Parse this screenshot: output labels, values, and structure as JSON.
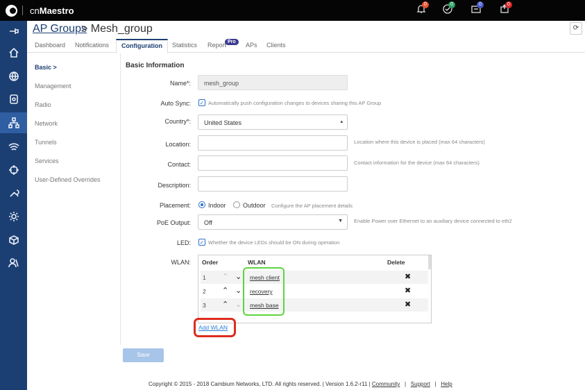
{
  "app": {
    "brand_prefix": "cn",
    "brand_name": "Maestro"
  },
  "topbar": {
    "badges": [
      "0",
      "0",
      "0",
      "0"
    ],
    "badge_colors": [
      "#e2522e",
      "#2f9e63",
      "#4a58c7",
      "#d42a2a"
    ]
  },
  "header": {
    "breadcrumb_link": "AP Groups",
    "breadcrumb_current": "> Mesh_group",
    "refresh_icon": "refresh-icon"
  },
  "tabs": [
    "Dashboard",
    "Notifications",
    "Configuration",
    "Statistics",
    "Report",
    "APs",
    "Clients"
  ],
  "pro_badge": "Pro",
  "leftnav": [
    "Basic >",
    "Management",
    "Radio",
    "Network",
    "Tunnels",
    "Services",
    "User-Defined Overrides"
  ],
  "form": {
    "section_title": "Basic Information",
    "name": {
      "label": "Name*:",
      "value": "mesh_group"
    },
    "autosync": {
      "label": "Auto Sync:",
      "hint": "Automatically push configuration changes to devices sharing this AP Group"
    },
    "country": {
      "label": "Country*:",
      "value": "United States"
    },
    "location": {
      "label": "Location:",
      "hint": "Location where this device is placed (max 64 characters)"
    },
    "contact": {
      "label": "Contact:",
      "hint": "Contact information for the device (max 64 characters)"
    },
    "description": {
      "label": "Description:"
    },
    "placement": {
      "label": "Placement:",
      "options": [
        "Indoor",
        "Outdoor"
      ],
      "hint": "Configure the AP placement details"
    },
    "poe": {
      "label": "PoE Output:",
      "value": "Off",
      "hint": "Enable Power over Ethernet to an auxiliary device connected to eth2"
    },
    "led": {
      "label": "LED:",
      "hint": "Whether the device LEDs should be ON during operation"
    },
    "wlan": {
      "label": "WLAN:",
      "headers": [
        "Order",
        "WLAN",
        "Delete"
      ],
      "rows": [
        {
          "order": "1",
          "name": "mesh client"
        },
        {
          "order": "2",
          "name": "recovery"
        },
        {
          "order": "3",
          "name": "mesh base"
        }
      ],
      "add_label": "Add WLAN"
    },
    "save_label": "Save"
  },
  "footer": {
    "copyright": "Copyright © 2015 - 2018 Cambium Networks, LTD. All rights reserved.  |  Version 1.6.2-r11  |",
    "community": "Community",
    "support": "Support",
    "help": "Help",
    "sep": "|"
  }
}
